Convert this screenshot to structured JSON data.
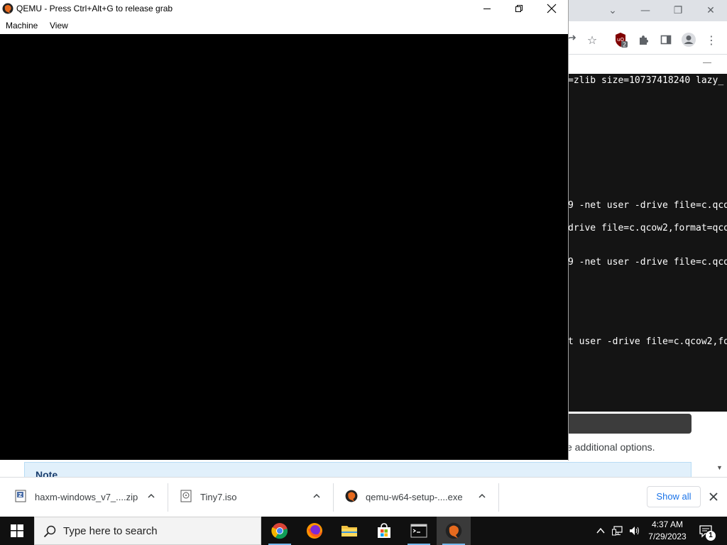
{
  "qemu": {
    "title": "QEMU - Press Ctrl+Alt+G to release grab",
    "menu": [
      "Machine",
      "View"
    ]
  },
  "chrome": {
    "extension_badge": "2",
    "terminal_lines": [
      "=zlib size=10737418240 lazy_",
      "9 -net user -drive file=c.qco",
      "drive file=c.qcow2,format=qco",
      "9 -net user -drive file=c.qco",
      "t user -drive file=c.qcow2,fo"
    ],
    "options_text": "e additional options.",
    "note_label": "Note"
  },
  "downloads": {
    "items": [
      {
        "name": "haxm-windows_v7_....zip",
        "icon": "zip-icon"
      },
      {
        "name": "Tiny7.iso",
        "icon": "iso-icon"
      },
      {
        "name": "qemu-w64-setup-....exe",
        "icon": "qemu-icon"
      }
    ],
    "show_all": "Show all"
  },
  "taskbar": {
    "search_placeholder": "Type here to search",
    "time": "4:37 AM",
    "date": "7/29/2023",
    "notification_count": "1",
    "apps": [
      "chrome-icon",
      "firefox-icon",
      "file-explorer-icon",
      "store-icon",
      "terminal-icon",
      "qemu-icon"
    ]
  }
}
